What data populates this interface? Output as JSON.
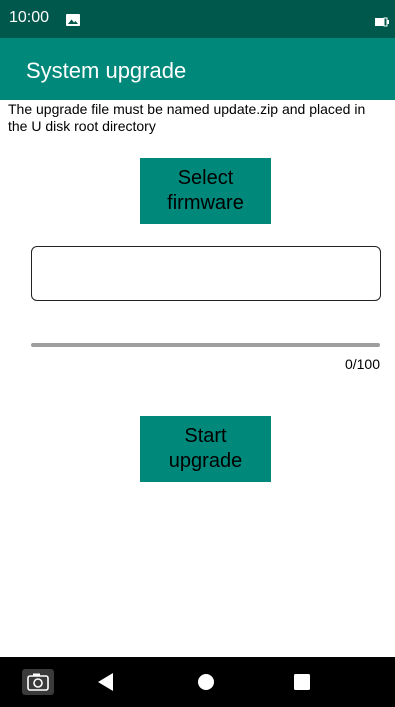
{
  "status_bar": {
    "time": "10:00",
    "icons": [
      "image-icon",
      "battery-icon"
    ]
  },
  "app_bar": {
    "title": "System upgrade"
  },
  "instruction": "The upgrade file must be named update.zip and placed in\nthe U disk root directory",
  "select_button_label": "Select\nfirmware",
  "firmware_path": {
    "value": "",
    "placeholder": ""
  },
  "progress": {
    "value": 0,
    "max": 100,
    "text": "0/100"
  },
  "start_button_label": "Start\nupgrade",
  "nav_bar": {
    "buttons": [
      "camera-icon",
      "back-icon",
      "home-icon",
      "recents-icon"
    ]
  },
  "colors": {
    "status_bar": "#00574b",
    "primary": "#00897b",
    "nav_bar": "#000000",
    "progress_track": "#9e9e9e"
  }
}
